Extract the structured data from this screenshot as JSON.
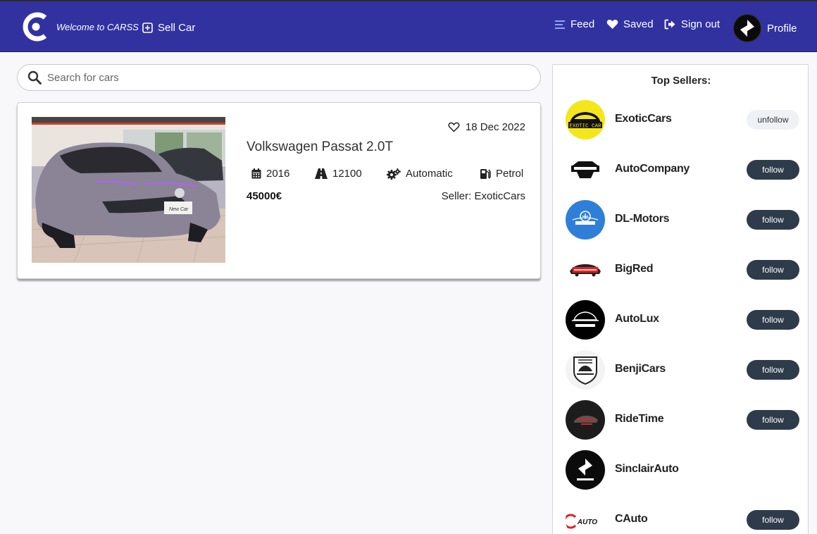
{
  "navbar": {
    "welcome": "Welcome to CARSS",
    "sell_car": "Sell Car",
    "feed": "Feed",
    "saved": "Saved",
    "sign_out": "Sign out",
    "profile": "Profile"
  },
  "search": {
    "placeholder": "Search for cars",
    "value": ""
  },
  "listing": {
    "date": "18 Dec 2022",
    "title": "Volkswagen Passat 2.0T",
    "year": "2016",
    "mileage": "12100",
    "transmission": "Automatic",
    "fuel": "Petrol",
    "price": "45000€",
    "seller": "Seller: ExoticCars",
    "saved": false
  },
  "top_sellers": {
    "title": "Top Sellers:",
    "sellers": [
      {
        "name": "ExoticCars",
        "button": "unfollow"
      },
      {
        "name": "AutoCompany",
        "button": "follow"
      },
      {
        "name": "DL-Motors",
        "button": "follow"
      },
      {
        "name": "BigRed",
        "button": "follow"
      },
      {
        "name": "AutoLux",
        "button": "follow"
      },
      {
        "name": "BenjiCars",
        "button": "follow"
      },
      {
        "name": "RideTime",
        "button": "follow"
      },
      {
        "name": "SinclairAuto",
        "button": ""
      },
      {
        "name": "CAuto",
        "button": "follow"
      }
    ]
  },
  "colors": {
    "navbar": "#3132a0",
    "follow_button": "#2e3b4a",
    "unfollow_button": "#eef2f6",
    "page_background": "#f8f8fa"
  }
}
